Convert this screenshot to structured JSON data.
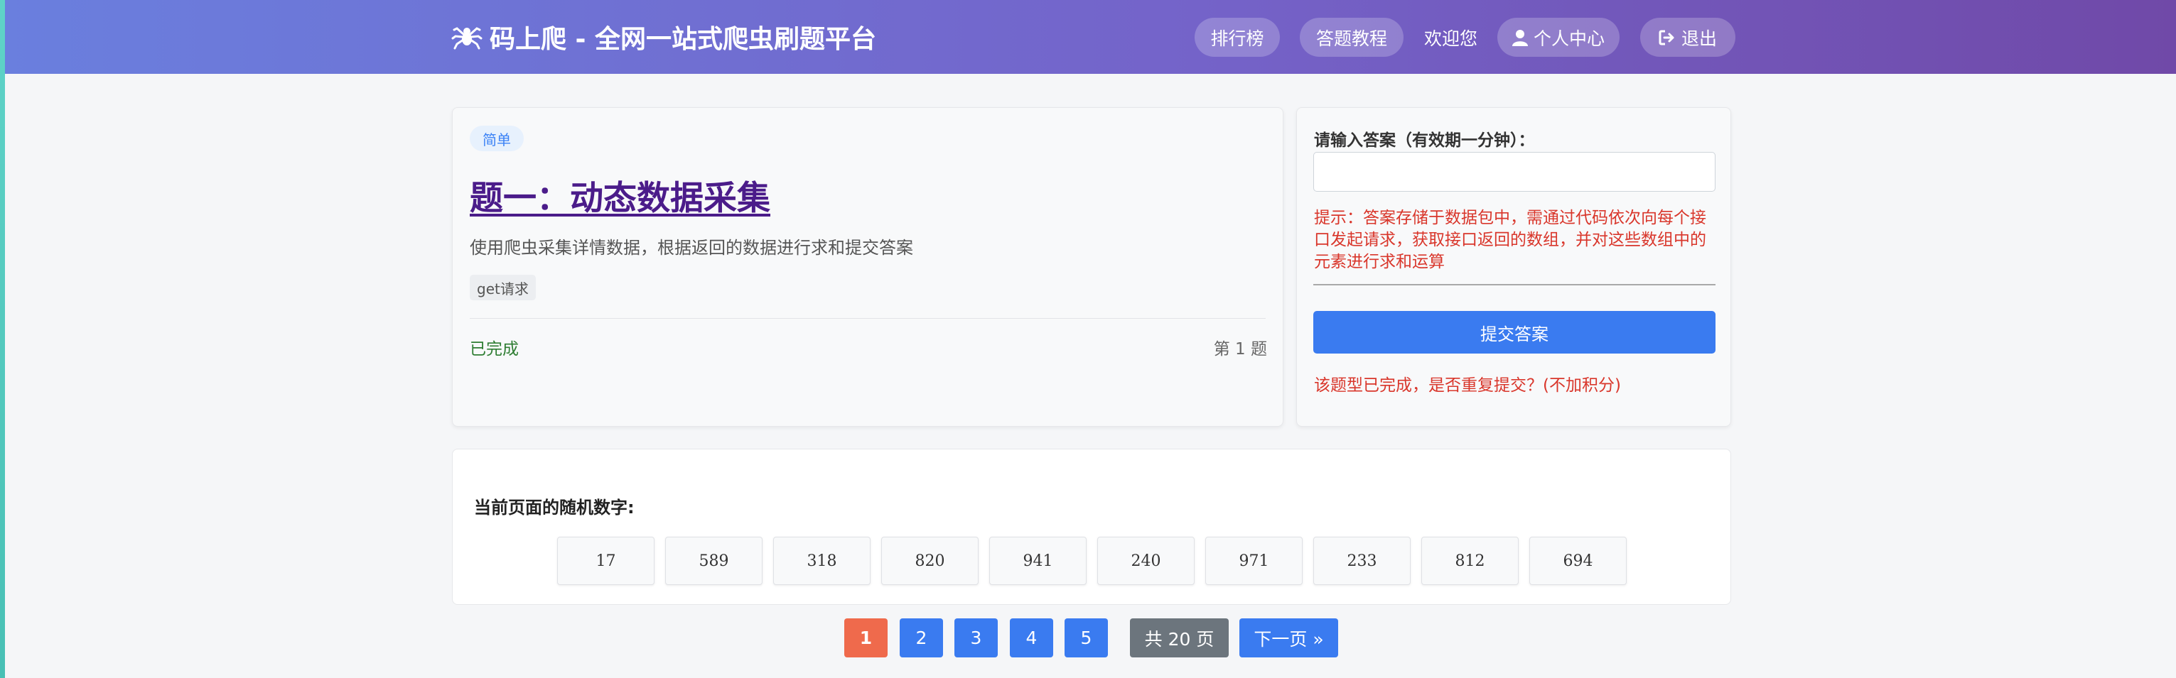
{
  "header": {
    "brand": "码上爬 - 全网一站式爬虫刷题平台",
    "nav": {
      "leaderboard": "排行榜",
      "tutorial": "答题教程",
      "welcome": "欢迎您",
      "profile": "个人中心",
      "logout": "退出"
    }
  },
  "question": {
    "difficulty": "简单",
    "title": "题一：动态数据采集",
    "description": "使用爬虫采集详情数据，根据返回的数据进行求和提交答案",
    "tag": "get请求",
    "status": "已完成",
    "number": "第 1 题"
  },
  "answer": {
    "label": "请输入答案（有效期一分钟）：",
    "value": "",
    "placeholder": "",
    "hint": "提示：答案存储于数据包中，需通过代码依次向每个接口发起请求，获取接口返回的数组，并对这些数组中的元素进行求和运算",
    "submit_label": "提交答案",
    "resubmit_note": "该题型已完成，是否重复提交？(不加积分)"
  },
  "random": {
    "title": "当前页面的随机数字:",
    "numbers": [
      "17",
      "589",
      "318",
      "820",
      "941",
      "240",
      "971",
      "233",
      "812",
      "694"
    ]
  },
  "pagination": {
    "pages": [
      "1",
      "2",
      "3",
      "4",
      "5"
    ],
    "current": "1",
    "total": "共 20 页",
    "next": "下一页 »"
  },
  "colors": {
    "header_start": "#6a7fde",
    "header_end": "#7049a8",
    "primary": "#3a7bf0",
    "active_page": "#ef6a4c",
    "danger": "#d9362b",
    "success": "#2e7d32"
  },
  "icons": [
    "spider-icon",
    "user-icon",
    "logout-icon"
  ]
}
